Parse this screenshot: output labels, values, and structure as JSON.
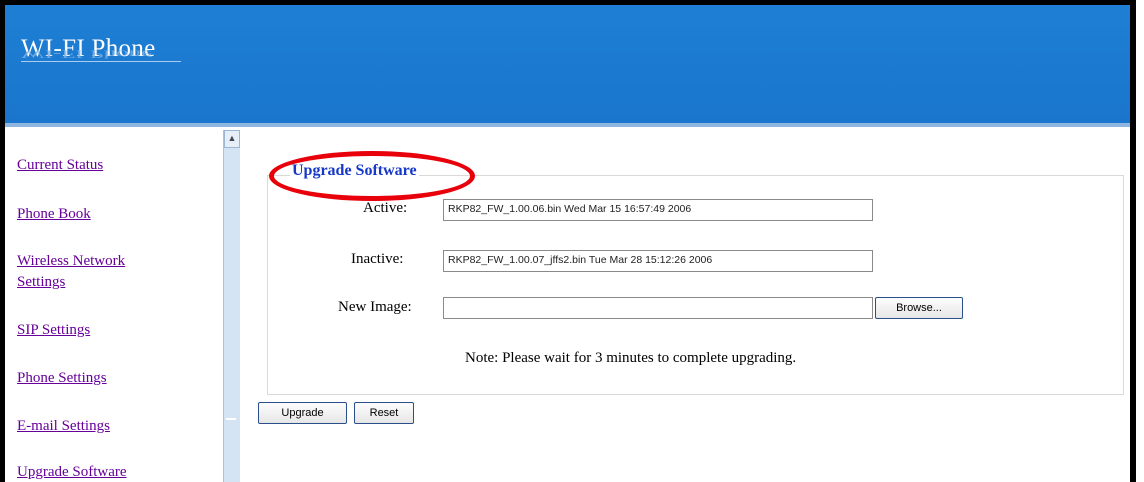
{
  "app": {
    "title": "WI-FI Phone"
  },
  "sidebar": {
    "items": [
      {
        "label": "Current Status"
      },
      {
        "label": "Phone Book"
      },
      {
        "label": "Wireless Network"
      },
      {
        "label": "Settings"
      },
      {
        "label": "SIP Settings"
      },
      {
        "label": "Phone Settings"
      },
      {
        "label": "E-mail Settings"
      },
      {
        "label": "Upgrade Software"
      }
    ]
  },
  "scrollbar": {
    "up_glyph": "▲"
  },
  "form": {
    "legend": "Upgrade Software",
    "active_label": "Active:",
    "active_value": "RKP82_FW_1.00.06.bin Wed Mar 15 16:57:49 2006",
    "inactive_label": "Inactive:",
    "inactive_value": "RKP82_FW_1.00.07_jffs2.bin Tue Mar 28 15:12:26 2006",
    "new_image_label": "New Image:",
    "new_image_value": "",
    "browse_label": "Browse...",
    "note": "Note: Please wait for 3 minutes to complete upgrading."
  },
  "actions": {
    "upgrade_label": "Upgrade",
    "reset_label": "Reset"
  },
  "colors": {
    "header": "#1976cc",
    "link": "#660099",
    "legend": "#1637c8",
    "highlight": "#e8000b"
  }
}
